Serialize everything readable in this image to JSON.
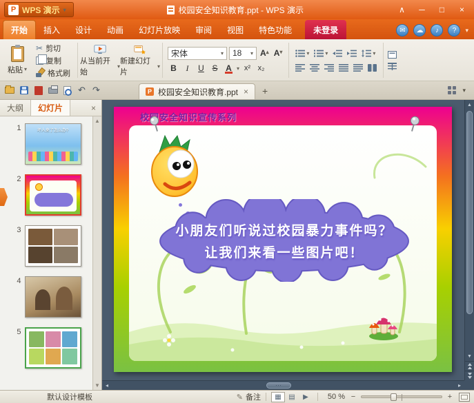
{
  "window": {
    "app_name": "WPS 演示",
    "title": "校园安全知识教育.ppt - WPS 演示"
  },
  "menu": {
    "tabs": [
      {
        "label": "开始",
        "active": true
      },
      {
        "label": "插入"
      },
      {
        "label": "设计"
      },
      {
        "label": "动画"
      },
      {
        "label": "幻灯片放映"
      },
      {
        "label": "审阅"
      },
      {
        "label": "视图"
      },
      {
        "label": "特色功能"
      }
    ],
    "login_label": "未登录"
  },
  "ribbon": {
    "paste_label": "粘贴",
    "cut_label": "剪切",
    "copy_label": "复制",
    "format_painter_label": "格式刷",
    "from_current_label": "从当前开始",
    "new_slide_label": "新建幻灯片",
    "font_name": "宋体",
    "font_size": "18",
    "grow_font": "A",
    "shrink_font": "A",
    "bold": "B",
    "italic": "I",
    "underline": "U",
    "strike": "S",
    "font_color": "A",
    "superscript": "x²",
    "subscript": "x₂"
  },
  "docbar": {
    "tab_label": "校园安全知识教育.ppt"
  },
  "sidebar": {
    "outline_tab": "大纲",
    "slides_tab": "幻灯片",
    "slides": [
      {
        "num": "1",
        "caption": "坏人来了怎么办?"
      },
      {
        "num": "2",
        "selected": true
      },
      {
        "num": "3"
      },
      {
        "num": "4"
      },
      {
        "num": "5"
      }
    ]
  },
  "slide": {
    "series_title": "校园安全知识宣传系列",
    "cloud_text_line1": "小朋友们听说过校园暴力事件吗？",
    "cloud_text_line2": "让我们来看一些图片吧！"
  },
  "statusbar": {
    "template_name": "默认设计模板",
    "notes_label": "备注",
    "zoom_value": "50 %"
  },
  "icons": {
    "caret_down": "▾",
    "caret_up": "▴",
    "scissors": "✂",
    "undo": "↶",
    "redo": "↷",
    "pencil": "✎",
    "close": "×",
    "plus": "+",
    "chevron_up": "∧",
    "minimize": "─",
    "maximize": "□",
    "envelope": "✉",
    "cloud": "☁",
    "music": "♪",
    "help": "?",
    "view_normal": "▦",
    "view_sorter": "▤",
    "play": "▶",
    "minus": "−",
    "scroll_up": "▲",
    "scroll_down": "▼",
    "scroll_left": "◂",
    "scroll_right": "▸"
  },
  "colors": {
    "titlebar_orange": "#e05a12",
    "login_red": "#bb1335",
    "selection_red": "#e23b2e",
    "cloud_purple": "#8074d6",
    "slide_top_magenta": "#ee0090",
    "slide_bottom_green": "#7ac143",
    "canvas_bg": "#4a5b6d"
  }
}
